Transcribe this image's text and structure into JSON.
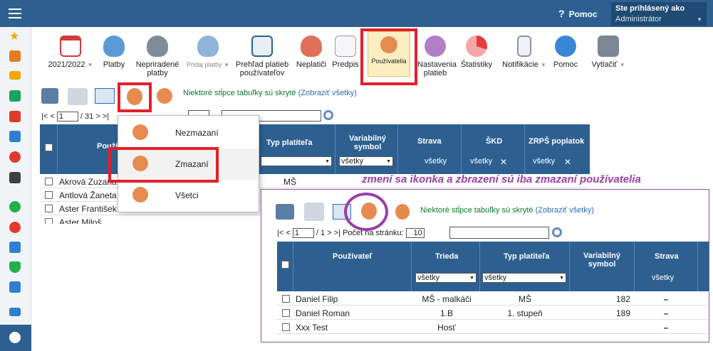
{
  "header": {
    "help_label": "Pomoc",
    "help_icon": "?",
    "user_box_title": "Ste prihlásený ako",
    "user_box_value": "Administrátor"
  },
  "toolbar": {
    "year": "2021/2022",
    "platby": "Platby",
    "nepriradene_line1": "Nepriradené",
    "nepriradene_line2": "platby",
    "pridaj_platby": "Pridaj platby",
    "prehlad_line1": "Prehľad platieb",
    "prehlad_line2": "používateľov",
    "neplatici": "Neplatiči",
    "predpis": "Predpis",
    "pouzivatelia": "Používatelia",
    "nastavenia_line1": "Nastavenia",
    "nastavenia_line2": "platieb",
    "statistiky": "Štatistiky",
    "notifikacie": "Notifikácie",
    "pomoc": "Pomoc",
    "vytlacit": "Vytlačiť"
  },
  "controls": {
    "hidden_cols_text": "Niektoré stĺpce tabuľky sú skryté",
    "show_all_link": "(Zobraziť všetky)",
    "page_prev": "|< <",
    "page_current": "1",
    "page_total": "/ 31",
    "page_next": "> >|"
  },
  "dropdown": {
    "items": [
      {
        "label": "Nezmazaní"
      },
      {
        "label": "Zmazaní"
      },
      {
        "label": "Všetci"
      }
    ]
  },
  "main_table": {
    "col_user": "Použí",
    "col_payer": "Typ platiteľa",
    "col_var_line1": "Variabilný",
    "col_var_line2": "symbol",
    "col_strava": "Strava",
    "col_skd": "ŠKD",
    "col_zrps": "ZRPŠ poplatok",
    "filter_all": "všetky",
    "rows": [
      {
        "name": "Akrová Zuzana",
        "payer": "MŠ"
      },
      {
        "name": "Antlová Žaneta",
        "payer": ""
      },
      {
        "name": "Aster František",
        "payer": ""
      },
      {
        "name": "Aster Miloš",
        "payer": ""
      }
    ]
  },
  "annotation": "zmení sa ikonka a zbrazení sú iba zmazaní používatelia",
  "panel": {
    "hidden_cols_text": "Niektoré stĺpce tabuľky sú skryté",
    "show_all_link": "(Zobraziť všetky)",
    "page_prev": "|< <",
    "page_current": "1",
    "page_total": "/ 1",
    "page_next": "> >|",
    "per_page_label": "Počet na stránku:",
    "per_page_value": "10",
    "search_value": "",
    "col_user": "Používateľ",
    "col_class": "Trieda",
    "col_payer": "Typ platiteľa",
    "col_var_line1": "Variabilný",
    "col_var_line2": "symbol",
    "col_strava": "Strava",
    "filter_all": "všetky",
    "rows": [
      {
        "name": "Daniel Filip",
        "class": "MŠ - malkáči",
        "payer": "MŠ",
        "vs": "182",
        "strava": "–"
      },
      {
        "name": "Daniel Roman",
        "class": "1.B",
        "payer": "1. stupeň",
        "vs": "189",
        "strava": "–"
      },
      {
        "name": "Xxx Test",
        "class": "Hosť",
        "payer": "",
        "vs": "",
        "strava": "–"
      }
    ]
  },
  "colors": {
    "brand": "#2d5f91",
    "highlight_red": "#e2202a",
    "annotation_purple": "#9b3fa6",
    "notice_green": "#0a7a2b"
  }
}
